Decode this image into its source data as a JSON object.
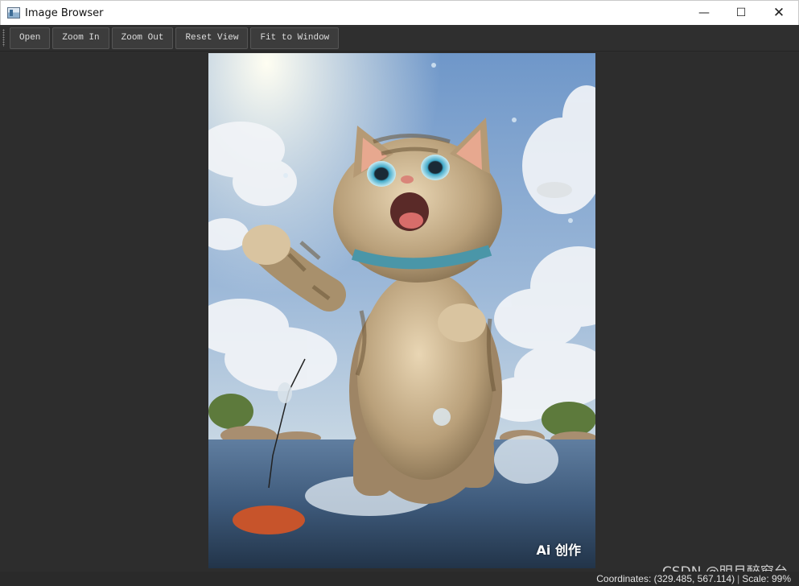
{
  "window": {
    "title": "Image Browser",
    "minimize_glyph": "—",
    "maximize_glyph": "☐",
    "close_glyph": "✕"
  },
  "toolbar": {
    "buttons": [
      {
        "label": "Open"
      },
      {
        "label": "Zoom In"
      },
      {
        "label": "Zoom Out"
      },
      {
        "label": "Reset View"
      },
      {
        "label": "Fit to Window"
      }
    ]
  },
  "image": {
    "subject": "cartoon tabby cat standing in water with raised paw",
    "watermark": "Ai 创作"
  },
  "overlay": {
    "csdn_watermark": "CSDN @明月醉窗台"
  },
  "status": {
    "coordinates": "Coordinates: (329.485, 567.114)",
    "separator": "|",
    "scale": "Scale: 99%"
  },
  "colors": {
    "titlebar_bg": "#ffffff",
    "toolbar_bg": "#2f2f2f",
    "viewport_bg": "#2d2d2d",
    "button_bg": "#3c3c3c",
    "button_text": "#dedede",
    "statusbar_text": "#e2e2e2"
  }
}
